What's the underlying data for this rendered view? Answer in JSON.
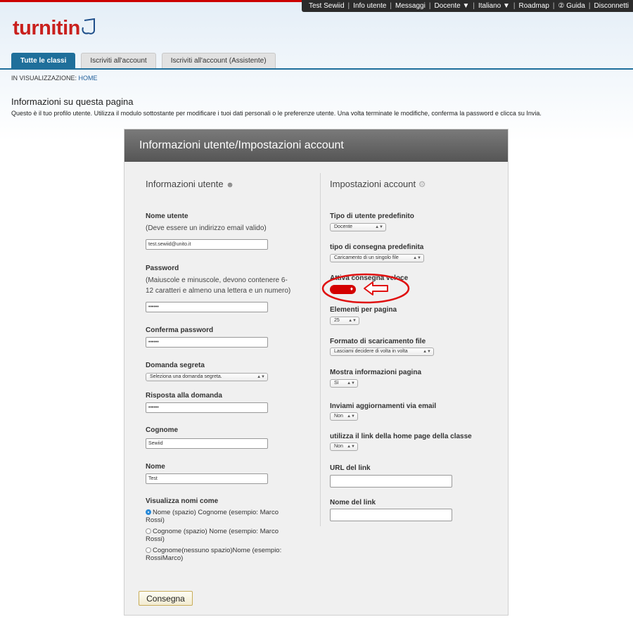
{
  "topnav": {
    "items": [
      "Test Sewiid",
      "Info utente",
      "Messaggi",
      "Docente ▼",
      "Italiano ▼",
      "Roadmap",
      "② Guida",
      "Disconnetti"
    ]
  },
  "logo": {
    "text": "turnitin"
  },
  "tabs": [
    {
      "label": "Tutte le classi",
      "active": true
    },
    {
      "label": "Iscriviti all'account",
      "active": false
    },
    {
      "label": "Iscriviti all'account (Assistente)",
      "active": false
    }
  ],
  "breadcrumb": {
    "prefix": "IN VISUALIZZAZIONE: ",
    "link": "HOME"
  },
  "info": {
    "title": "Informazioni su questa pagina",
    "description": "Questo è il tuo profilo utente. Utilizza il modulo sottostante per modificare i tuoi dati personali o le preferenze utente. Una volta terminate le modifiche, conferma la password e clicca su Invia."
  },
  "panel": {
    "title": "Informazioni utente/Impostazioni account",
    "left": {
      "section_title": "Informazioni utente",
      "username_label": "Nome utente",
      "username_hint": "(Deve essere un indirizzo email valido)",
      "username_value": "test.sewiid@unito.it",
      "password_label": "Password",
      "password_hint": "(Maiuscole e minuscole, devono contenere 6-12 caratteri e almeno una lettera e un numero)",
      "password_value": "••••••",
      "confirm_label": "Conferma password",
      "confirm_value": "••••••",
      "secret_label": "Domanda segreta",
      "secret_value": "Seleziona una domanda segreta.",
      "answer_label": "Risposta alla domanda",
      "answer_value": "••••••",
      "surname_label": "Cognome",
      "surname_value": "Sewiid",
      "name_label": "Nome",
      "name_value": "Test",
      "display_label": "Visualizza nomi come",
      "display_options": [
        {
          "label": "Nome (spazio) Cognome (esempio: Marco Rossi)",
          "checked": true
        },
        {
          "label": "Cognome (spazio) Nome (esempio: Marco Rossi)",
          "checked": false
        },
        {
          "label": "Cognome(nessuno spazio)Nome (esempio: RossiMarco)",
          "checked": false
        }
      ]
    },
    "right": {
      "section_title": "Impostazioni account",
      "user_type_label": "Tipo di utente predefinito",
      "user_type_value": "Docente",
      "submission_type_label": "tipo di consegna predefinita",
      "submission_type_value": "Caricamento di un singolo file",
      "quick_submit_label": "Attiva consegna veloce",
      "quick_submit_state": "off",
      "items_per_page_label": "Elementi per pagina",
      "items_per_page_value": "25",
      "download_format_label": "Formato di scaricamento file",
      "download_format_value": "Lasciami decidere di volta in volta",
      "show_info_label": "Mostra informazioni pagina",
      "show_info_value": "Sì",
      "email_updates_label": "Inviami aggiornamenti via email",
      "email_updates_value": "Non",
      "homepage_link_label": "utilizza il link della home page della classe",
      "homepage_link_value": "Non",
      "link_url_label": "URL del link",
      "link_url_value": "",
      "link_name_label": "Nome del link",
      "link_name_value": ""
    },
    "submit_label": "Consegna"
  },
  "colors": {
    "brand_red": "#c9201d",
    "tab_blue": "#1f6f9b",
    "annotation_red": "#e01010",
    "toggle_red": "#d40000",
    "radio_blue": "#2a8ad8"
  },
  "icons": [
    "user-icon",
    "gear-icon",
    "logo-mark-icon",
    "help-icon",
    "arrow-left-annotation-icon"
  ]
}
